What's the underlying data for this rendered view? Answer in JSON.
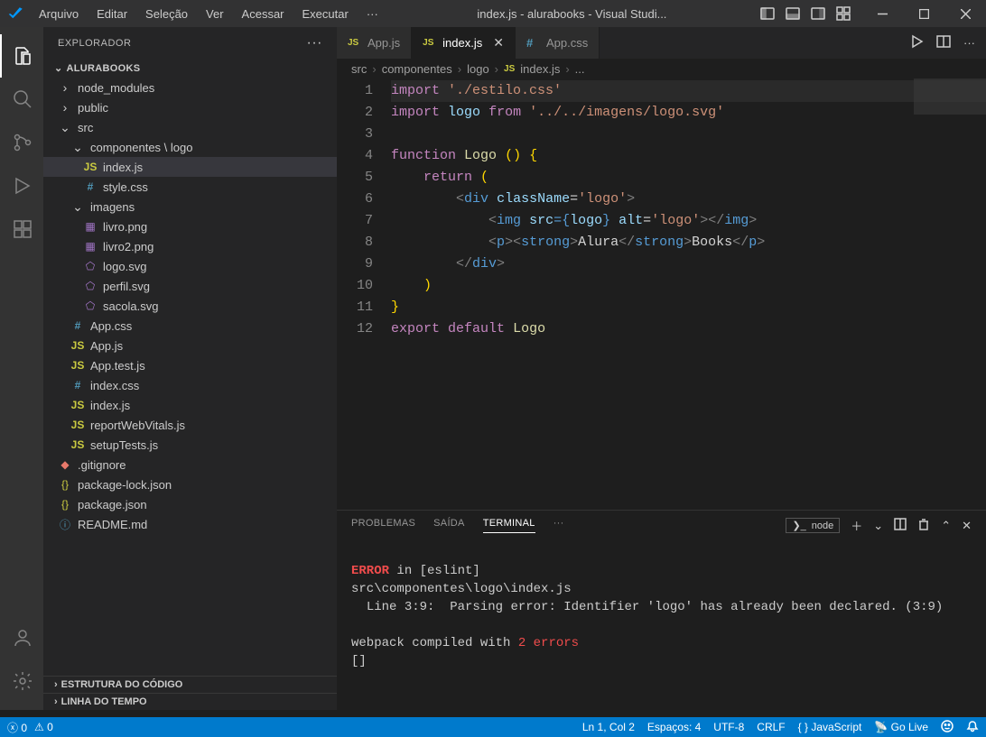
{
  "titlebar": {
    "menus": [
      "Arquivo",
      "Editar",
      "Seleção",
      "Ver",
      "Acessar",
      "Executar",
      "···"
    ],
    "title": "index.js - alurabooks - Visual Studi..."
  },
  "sidebar": {
    "title": "EXPLORADOR",
    "root": "ALURABOOKS",
    "sections": {
      "outline": "ESTRUTURA DO CÓDIGO",
      "timeline": "LINHA DO TEMPO"
    },
    "tree": {
      "node_modules": "node_modules",
      "public": "public",
      "src": "src",
      "componentes_logo": "componentes \\ logo",
      "indexjs": "index.js",
      "stylecss": "style.css",
      "imagens": "imagens",
      "livro": "livro.png",
      "livro2": "livro2.png",
      "logosvg": "logo.svg",
      "perfil": "perfil.svg",
      "sacola": "sacola.svg",
      "appcss": "App.css",
      "appjs": "App.js",
      "apptest": "App.test.js",
      "indexcss": "index.css",
      "indexjs2": "index.js",
      "report": "reportWebVitals.js",
      "setup": "setupTests.js",
      "gitignore": ".gitignore",
      "pkglock": "package-lock.json",
      "pkg": "package.json",
      "readme": "README.md"
    }
  },
  "tabs": {
    "appjs": "App.js",
    "indexjs": "index.js",
    "appcss": "App.css"
  },
  "breadcrumb": {
    "p1": "src",
    "p2": "componentes",
    "p3": "logo",
    "p4": "index.js",
    "p5": "..."
  },
  "code": {
    "l1": {
      "a": "import",
      "b": "'./estilo.css'"
    },
    "l2": {
      "a": "import",
      "b": "logo",
      "c": "from",
      "d": "'../../imagens/logo.svg'"
    },
    "l4": {
      "a": "function",
      "b": "Logo",
      "c": "() {"
    },
    "l5": {
      "a": "return",
      "b": "("
    },
    "l6": {
      "a": "<",
      "b": "div",
      "c": "className",
      "d": "=",
      "e": "'logo'",
      "f": ">"
    },
    "l7": {
      "a": "<",
      "b": "img",
      "c": "src",
      "d": "={",
      "e": "logo",
      "f": "}",
      "g": "alt",
      "h": "=",
      "i": "'logo'",
      "j": "></",
      "k": "img",
      "l": ">"
    },
    "l8": {
      "a": "<",
      "b": "p",
      "c": "><",
      "d": "strong",
      "e": ">",
      "f": "Alura",
      "g": "</",
      "h": "strong",
      "i": ">",
      "j": "Books",
      "k": "</",
      "l": "p",
      "m": ">"
    },
    "l9": {
      "a": "</",
      "b": "div",
      "c": ">"
    },
    "l10": {
      "a": ")"
    },
    "l11": {
      "a": "}"
    },
    "l12": {
      "a": "export",
      "b": "default",
      "c": "Logo"
    }
  },
  "panel": {
    "tabs": {
      "problems": "PROBLEMAS",
      "output": "SAÍDA",
      "terminal": "TERMINAL",
      "more": "···"
    },
    "type": "node"
  },
  "terminal": {
    "l1a": "ERROR",
    "l1b": " in [eslint]",
    "l2": "src\\componentes\\logo\\index.js",
    "l3": "  Line 3:9:  Parsing error: Identifier 'logo' has already been declared. (3:9)",
    "l4": "webpack compiled with ",
    "l4b": "2 errors",
    "l5": "[]"
  },
  "status": {
    "errors": "0",
    "warnings": "0",
    "pos": "Ln 1, Col 2",
    "spaces": "Espaços: 4",
    "enc": "UTF-8",
    "eol": "CRLF",
    "lang": "JavaScript",
    "golive": "Go Live"
  }
}
